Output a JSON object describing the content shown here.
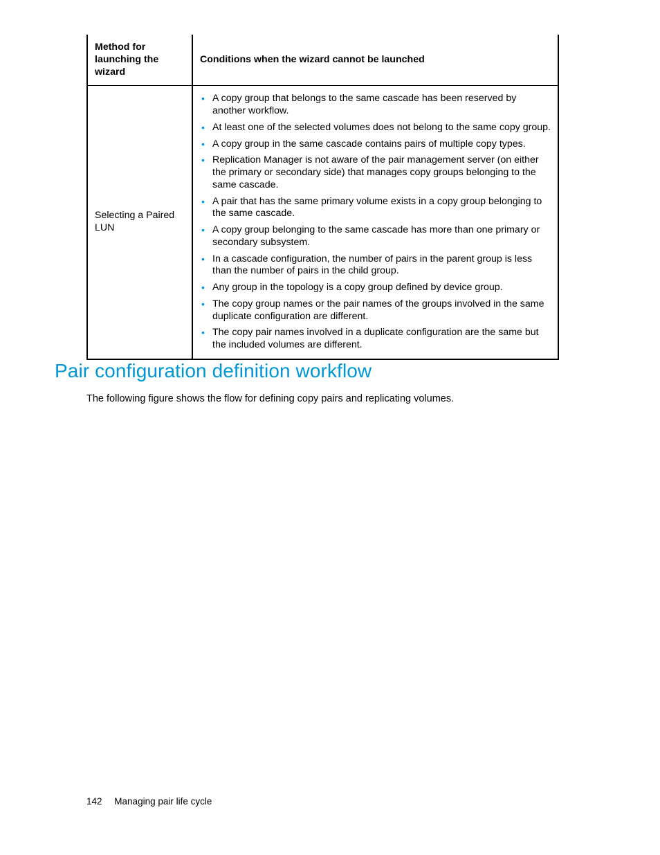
{
  "table": {
    "header": {
      "left": "Method for launching the wizard",
      "right": "Conditions when the wizard cannot be launched"
    },
    "row": {
      "method": "Selecting a Paired LUN",
      "conditions": [
        "A copy group that belongs to the same cascade has been reserved by another workflow.",
        "At least one of the selected volumes does not belong to the same copy group.",
        "A copy group in the same cascade contains pairs of multiple copy types.",
        "Replication Manager is not aware of the pair management server (on either the primary or secondary side) that manages copy groups belonging to the same cascade.",
        "A pair that has the same primary volume exists in a copy group belonging to the same cascade.",
        "A copy group belonging to the same cascade has more than one primary or secondary subsystem.",
        "In a cascade configuration, the number of pairs in the parent group is less than the number of pairs in the child group.",
        "Any group in the topology is a copy group defined by device group.",
        "The copy group names or the pair names of the groups involved in the same duplicate configuration are different.",
        "The copy pair names involved in a duplicate configuration are the same but the included volumes are different."
      ]
    }
  },
  "heading": "Pair configuration definition workflow",
  "intro": "The following figure shows the flow for defining copy pairs and replicating volumes.",
  "footer": {
    "page_number": "142",
    "chapter": "Managing pair life cycle"
  }
}
